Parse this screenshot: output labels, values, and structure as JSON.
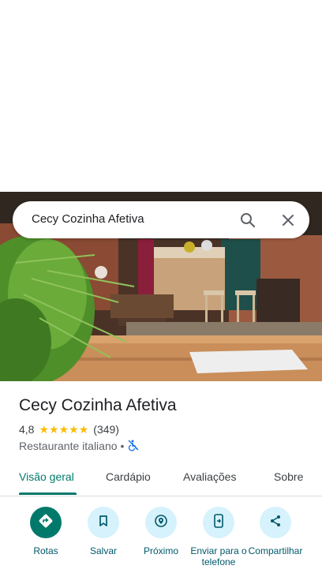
{
  "search": {
    "query": "Cecy Cozinha Afetiva"
  },
  "place": {
    "name": "Cecy Cozinha Afetiva",
    "rating": "4,8",
    "stars": 5,
    "review_count": "(349)",
    "category": "Restaurante italiano",
    "separator": "•"
  },
  "tabs": [
    {
      "label": "Visão geral"
    },
    {
      "label": "Cardápio"
    },
    {
      "label": "Avaliações"
    },
    {
      "label": "Sobre"
    }
  ],
  "actions": [
    {
      "label": "Rotas",
      "icon": "directions-icon"
    },
    {
      "label": "Salvar",
      "icon": "bookmark-icon"
    },
    {
      "label": "Próximo",
      "icon": "nearby-icon"
    },
    {
      "label": "Enviar para o telefone",
      "icon": "send-to-phone-icon"
    },
    {
      "label": "Compartilhar",
      "icon": "share-icon"
    }
  ],
  "colors": {
    "accent": "#00796b",
    "action_bg": "#d6f2fc",
    "star": "#fbbc04"
  }
}
